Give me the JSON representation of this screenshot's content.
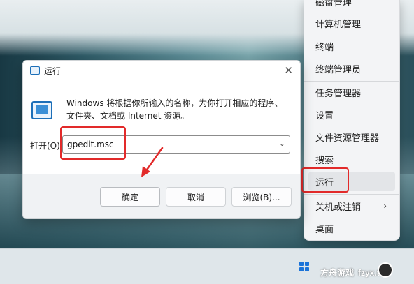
{
  "menu": {
    "items": [
      {
        "label": "磁盘管理"
      },
      {
        "label": "计算机管理"
      },
      {
        "label": "终端"
      },
      {
        "label": "终端管理员"
      },
      {
        "label": "任务管理器"
      },
      {
        "label": "设置"
      },
      {
        "label": "文件资源管理器"
      },
      {
        "label": "搜索"
      },
      {
        "label": "运行"
      },
      {
        "label": "关机或注销",
        "chevron": "›"
      },
      {
        "label": "桌面"
      }
    ]
  },
  "dialog": {
    "title": "运行",
    "close_glyph": "✕",
    "description": "Windows 将根据你所输入的名称，为你打开相应的程序、文件夹、文档或 Internet 资源。",
    "open_label": "打开(O):",
    "input_value": "gpedit.msc",
    "dropdown_glyph": "⌄",
    "ok_label": "确定",
    "cancel_label": "取消",
    "browse_label": "浏览(B)..."
  },
  "watermark": {
    "brand": "方舟游戏",
    "site": "fzyx.top"
  },
  "colors": {
    "highlight": "#e22a2a",
    "accent": "#1d6fb8"
  }
}
